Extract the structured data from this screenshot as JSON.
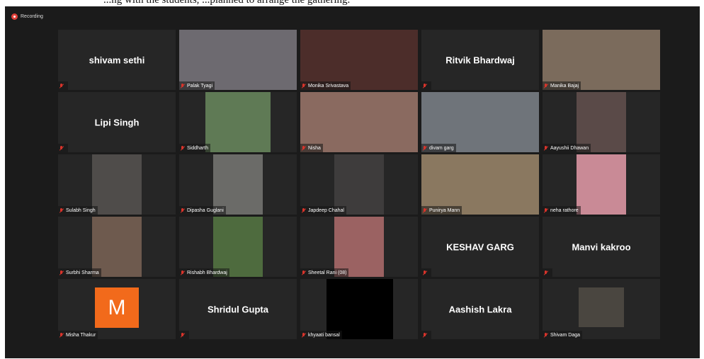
{
  "window": {
    "recording_label": "Recording"
  },
  "caption": "...ng with the students, ...planned to arrange the gathering.",
  "participants": [
    {
      "name": "shivam sethi",
      "video": false
    },
    {
      "name": "Palak Tyagi",
      "video": true,
      "color": "#6d6a70"
    },
    {
      "name": "Monika Srivastava",
      "video": true,
      "color": "#4c2d2a",
      "active": true
    },
    {
      "name": "Ritvik Bhardwaj",
      "video": false
    },
    {
      "name": "Manika Bajaj",
      "video": true,
      "color": "#7b6b5c"
    },
    {
      "name": "Lipi Singh",
      "video": false
    },
    {
      "name": "Siddharth",
      "video": true,
      "color": "#5f7a55",
      "pw": 92
    },
    {
      "name": "Nisha",
      "video": true,
      "color": "#8a6a60"
    },
    {
      "name": "divam garg",
      "video": true,
      "color": "#6f747a"
    },
    {
      "name": "Aayushii Dhawan",
      "video": true,
      "color": "#5a4a48",
      "pw": 70
    },
    {
      "name": "Sulabh Singh",
      "video": true,
      "color": "#4f4c4a",
      "pw": 70
    },
    {
      "name": "Dipasha Guglani",
      "video": true,
      "color": "#6b6b68",
      "pw": 70
    },
    {
      "name": "Japdeep Chahal",
      "video": true,
      "color": "#3e3c3c",
      "pw": 70
    },
    {
      "name": "Punirya Mann",
      "video": true,
      "color": "#8a7860"
    },
    {
      "name": "neha rathore",
      "video": true,
      "color": "#c98a96",
      "pw": 70
    },
    {
      "name": "Surbhi Sharma",
      "video": true,
      "color": "#6e5a4e",
      "pw": 70
    },
    {
      "name": "Rishabh Bhardwaj",
      "video": true,
      "color": "#4e6b3e",
      "pw": 70
    },
    {
      "name": "Sheetal Rani (08)",
      "video": true,
      "color": "#9b6262",
      "pw": 70
    },
    {
      "name": "KESHAV GARG",
      "video": false
    },
    {
      "name": "Manvi kakroo",
      "video": false
    },
    {
      "name": "Misha Thakur",
      "video": false,
      "avatar": "M"
    },
    {
      "name": "Shridul Gupta",
      "video": false
    },
    {
      "name": "khyaati bansal",
      "video": false,
      "black": true
    },
    {
      "name": "Aashish Lakra",
      "video": false
    },
    {
      "name": "Shivam Daga",
      "video": true,
      "color": "#4a4640",
      "pw": 64,
      "ph": 56
    }
  ]
}
